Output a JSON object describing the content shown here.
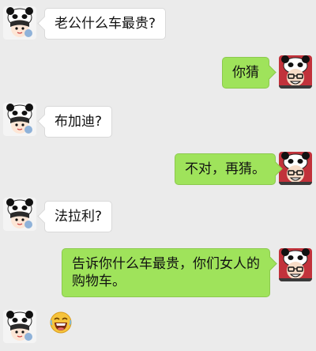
{
  "messages": [
    {
      "side": "left",
      "text": "老公什么车最贵?"
    },
    {
      "side": "right",
      "text": "你猜"
    },
    {
      "side": "left",
      "text": "布加迪?"
    },
    {
      "side": "right",
      "text": "不对，再猜。"
    },
    {
      "side": "left",
      "text": "法拉利?"
    },
    {
      "side": "right",
      "text": "告诉你什么车最贵，你们女人的购物车。"
    },
    {
      "side": "left",
      "emoji": "laughing-emoji"
    }
  ],
  "colors": {
    "background": "#ebebeb",
    "bubble_left": "#ffffff",
    "bubble_right": "#9fe35b"
  }
}
